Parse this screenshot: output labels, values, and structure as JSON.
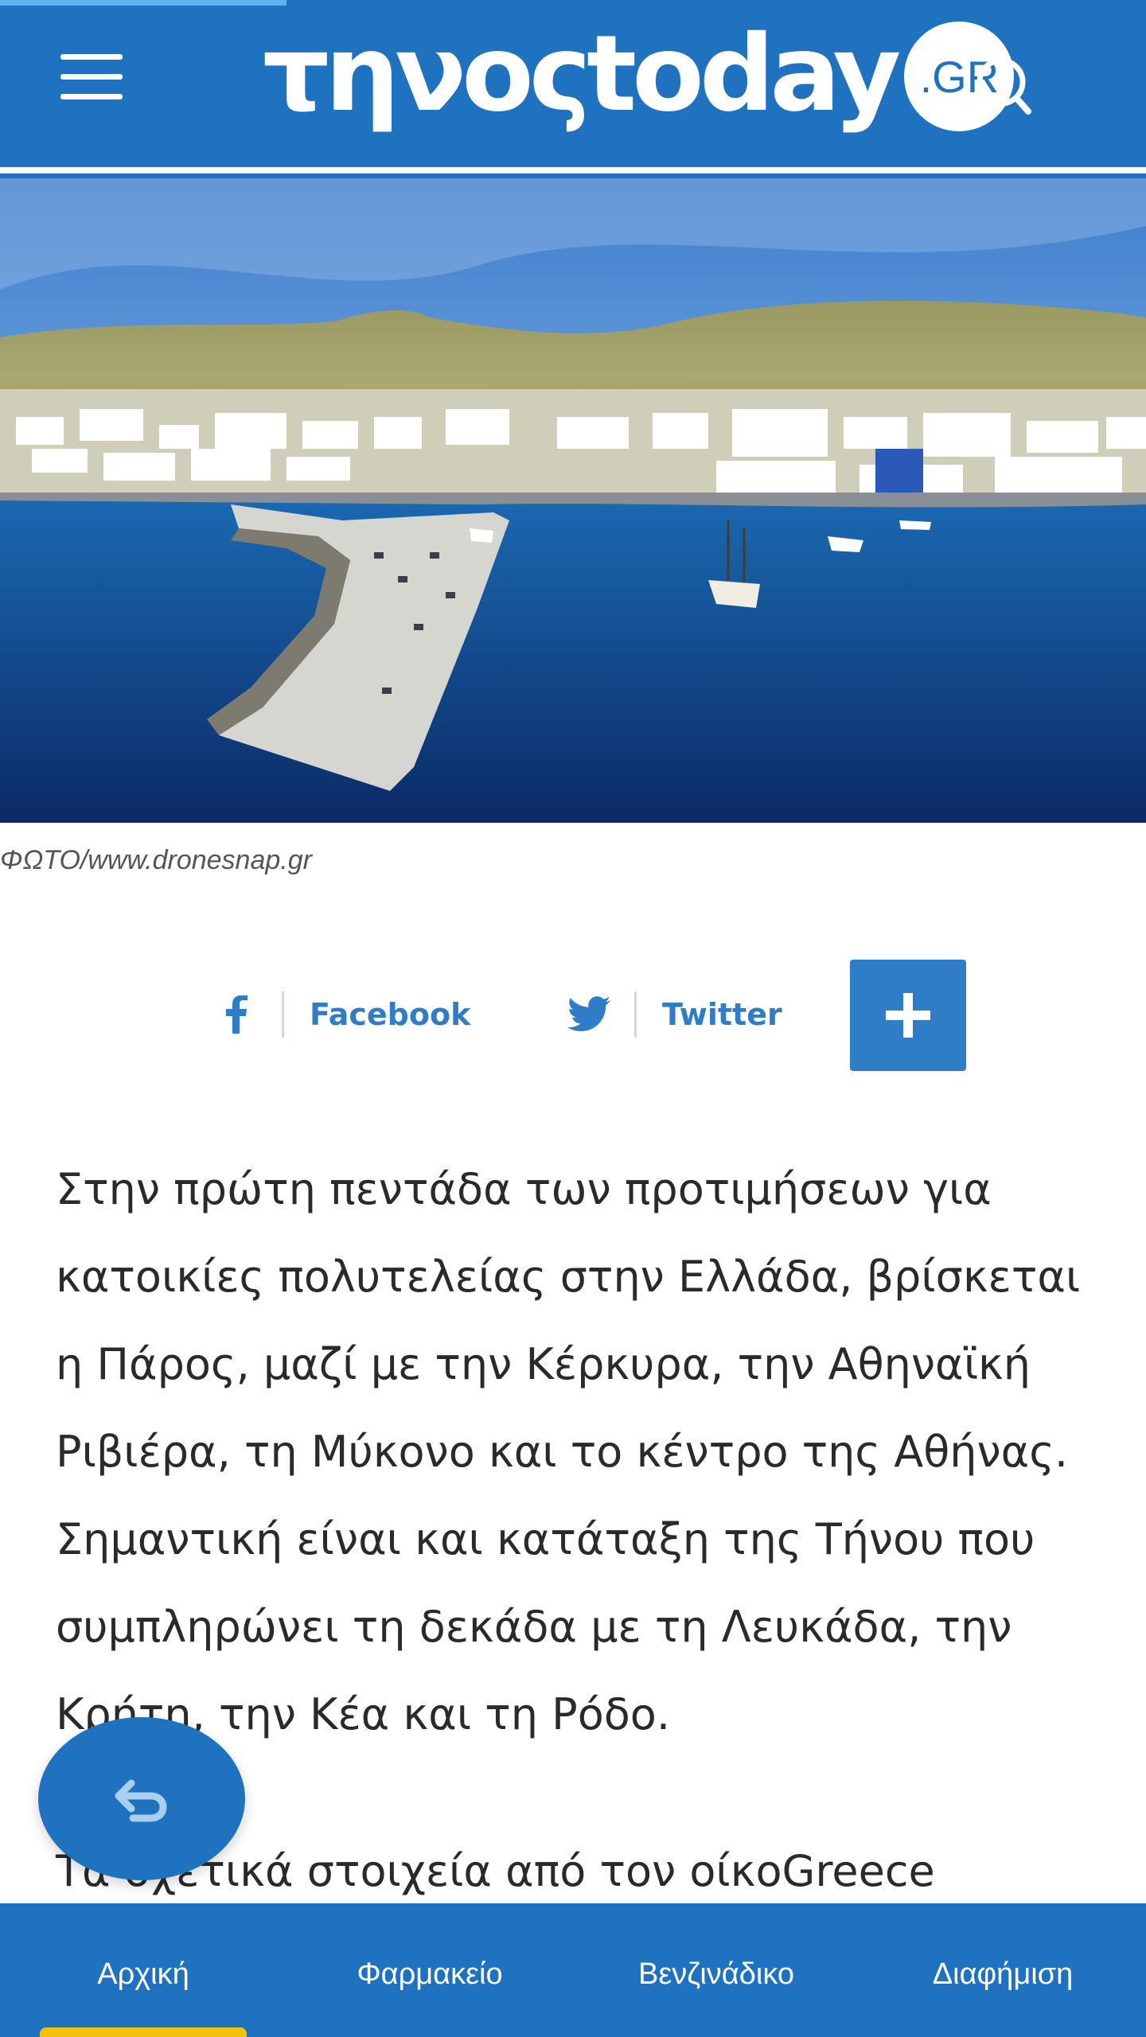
{
  "app": {
    "brand": "τηνοςtoday",
    "brand_suffix": ".GR",
    "accent_color": "#1f72c0",
    "reading_progress": 0.25
  },
  "hero": {
    "image_description_icon": "harbor-photo",
    "caption": "ΦΩΤΟ/www.dronesnap.gr"
  },
  "share": {
    "facebook_label": "Facebook",
    "twitter_label": "Twitter",
    "more_icon": "plus-icon"
  },
  "article": {
    "paragraphs": [
      "Στην πρώτη πεντάδα των προτιμήσεων για κατοικίες πολυτελείας στην Ελλάδα, βρίσκεται η Πάρος, μαζί με την Κέρκυρα, την Αθηναϊκή Ριβιέρα, τη Μύκονο και το κέντρο της Αθήνας. Σημαντική είναι και κατάταξη της Τήνου που συμπληρώνει τη δεκάδα με τη Λευκάδα, την Κρήτη, την Κέα και τη Ρόδο.",
      "Τα σχετικά στοιχεία από τον οίκοGreece"
    ]
  },
  "bottom_nav": {
    "items": [
      {
        "label": "Αρχική",
        "active": true
      },
      {
        "label": "Φαρμακείο",
        "active": false
      },
      {
        "label": "Βενζινάδικο",
        "active": false
      },
      {
        "label": "Διαφήμιση",
        "active": false
      }
    ],
    "active_color": "#f4c20d"
  }
}
